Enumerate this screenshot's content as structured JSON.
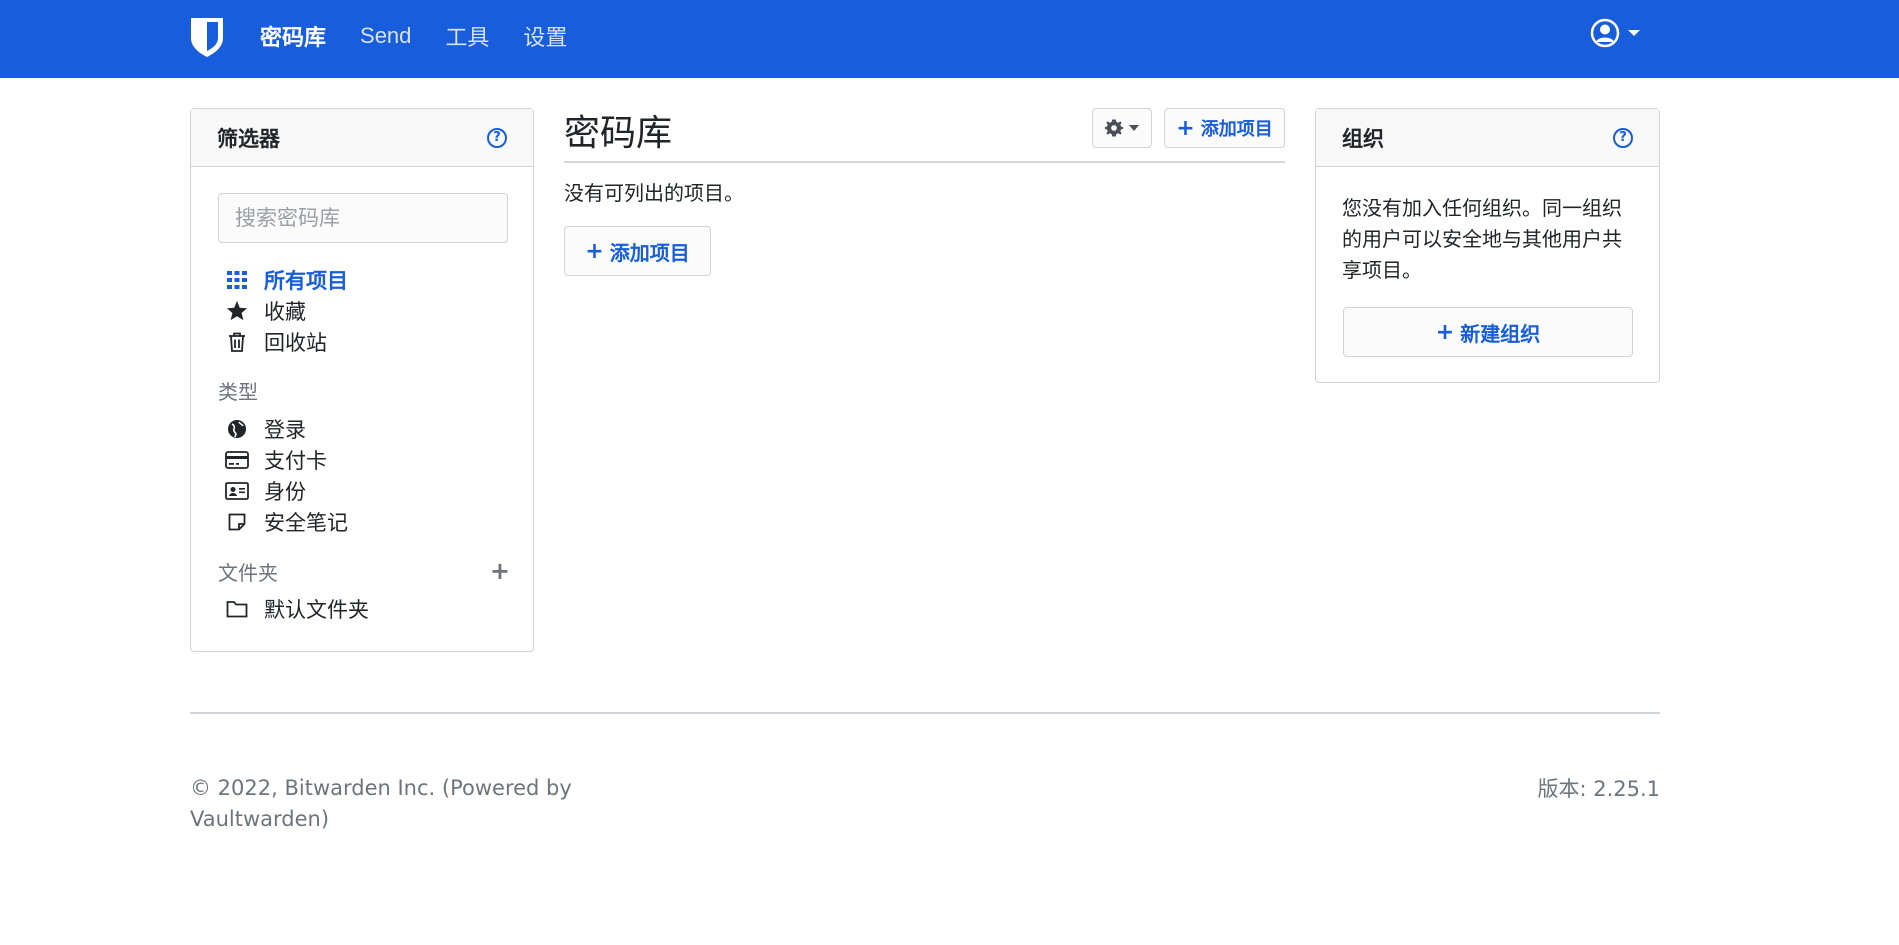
{
  "nav": {
    "items": [
      {
        "label": "密码库",
        "active": true
      },
      {
        "label": "Send",
        "active": false
      },
      {
        "label": "工具",
        "active": false
      },
      {
        "label": "设置",
        "active": false
      }
    ],
    "brand_color": "#175ddc"
  },
  "filter": {
    "title": "筛选器",
    "search_placeholder": "搜索密码库",
    "items": [
      {
        "label": "所有项目",
        "icon": "grid-icon",
        "active": true
      },
      {
        "label": "收藏",
        "icon": "star-icon"
      },
      {
        "label": "回收站",
        "icon": "trash-icon"
      }
    ],
    "types_heading": "类型",
    "types": [
      {
        "label": "登录",
        "icon": "globe-icon"
      },
      {
        "label": "支付卡",
        "icon": "credit-card-icon"
      },
      {
        "label": "身份",
        "icon": "id-card-icon"
      },
      {
        "label": "安全笔记",
        "icon": "sticky-note-icon"
      }
    ],
    "folders_heading": "文件夹",
    "folders": [
      {
        "label": "默认文件夹",
        "icon": "folder-icon"
      }
    ]
  },
  "main": {
    "title": "密码库",
    "add_item_label": "添加项目",
    "empty_text": "没有可列出的项目。"
  },
  "org": {
    "title": "组织",
    "text": "您没有加入任何组织。同一组织的用户可以安全地与其他用户共享项目。",
    "new_org_label": "新建组织"
  },
  "footer": {
    "copyright": "© 2022, Bitwarden Inc. (Powered by Vaultwarden)",
    "version": "版本: 2.25.1"
  }
}
